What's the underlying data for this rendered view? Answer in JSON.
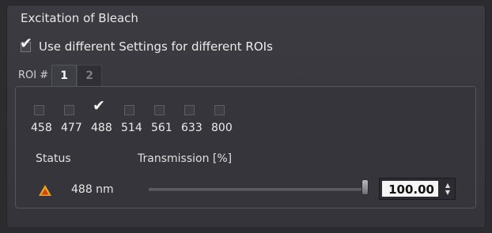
{
  "panel": {
    "title": "Excitation of Bleach"
  },
  "use_different": {
    "label": "Use different Settings for different ROIs",
    "checked": true
  },
  "roi_tabs": {
    "prefix": "ROI #",
    "items": [
      "1",
      "2"
    ],
    "active": "1"
  },
  "laser_lines": [
    {
      "label": "458",
      "checked": false
    },
    {
      "label": "477",
      "checked": false
    },
    {
      "label": "488",
      "checked": true
    },
    {
      "label": "514",
      "checked": false
    },
    {
      "label": "561",
      "checked": false
    },
    {
      "label": "633",
      "checked": false
    },
    {
      "label": "800",
      "checked": false
    }
  ],
  "headers": {
    "status": "Status",
    "transmission": "Transmission [%]"
  },
  "row": {
    "status_icon": "warning-icon",
    "wavelength": "488 nm",
    "transmission_value": "100.00",
    "transmission_fraction": 1.0
  },
  "colors": {
    "warning": "#e8a020",
    "warning_dark": "#d0401a"
  }
}
